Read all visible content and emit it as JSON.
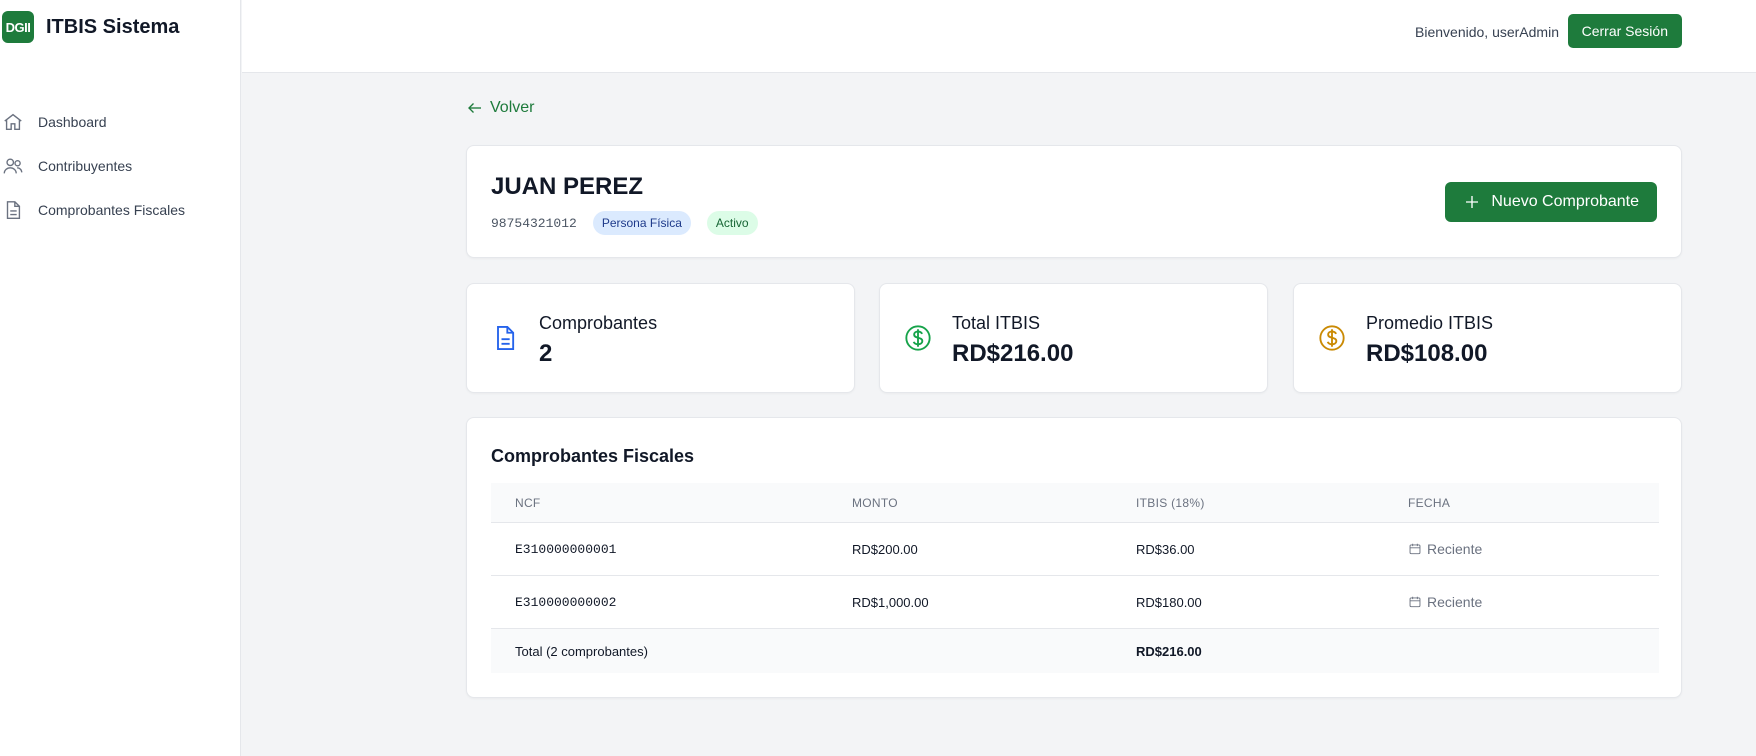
{
  "brand": {
    "logo_text": "DGII",
    "name": "ITBIS Sistema"
  },
  "sidebar": {
    "items": [
      {
        "label": "Dashboard",
        "icon": "home-icon"
      },
      {
        "label": "Contribuyentes",
        "icon": "users-icon"
      },
      {
        "label": "Comprobantes Fiscales",
        "icon": "document-icon"
      }
    ]
  },
  "header": {
    "welcome": "Bienvenido, userAdmin",
    "logout_label": "Cerrar Sesión"
  },
  "main": {
    "back_label": "Volver",
    "taxpayer": {
      "name": "JUAN PEREZ",
      "rnc": "98754321012",
      "type_badge": "Persona Física",
      "status_badge": "Activo"
    },
    "new_button_label": "Nuevo Comprobante",
    "stats": [
      {
        "label": "Comprobantes",
        "value": "2",
        "icon": "file-text-icon",
        "color": "#2563eb"
      },
      {
        "label": "Total ITBIS",
        "value": "RD$216.00",
        "icon": "dollar-circle-icon",
        "color": "#16a34a"
      },
      {
        "label": "Promedio ITBIS",
        "value": "RD$108.00",
        "icon": "dollar-circle-icon",
        "color": "#ca8a04"
      }
    ],
    "table": {
      "title": "Comprobantes Fiscales",
      "columns": [
        "NCF",
        "MONTO",
        "ITBIS (18%)",
        "FECHA"
      ],
      "rows": [
        {
          "ncf": "E310000000001",
          "monto": "RD$200.00",
          "itbis": "RD$36.00",
          "fecha": "Reciente"
        },
        {
          "ncf": "E310000000002",
          "monto": "RD$1,000.00",
          "itbis": "RD$180.00",
          "fecha": "Reciente"
        }
      ],
      "footer": {
        "label": "Total (2 comprobantes)",
        "total_itbis": "RD$216.00"
      }
    }
  },
  "colors": {
    "brand_green": "#1e7b3c",
    "badge_blue_bg": "#dbeafe",
    "badge_green_bg": "#dcfce7"
  }
}
